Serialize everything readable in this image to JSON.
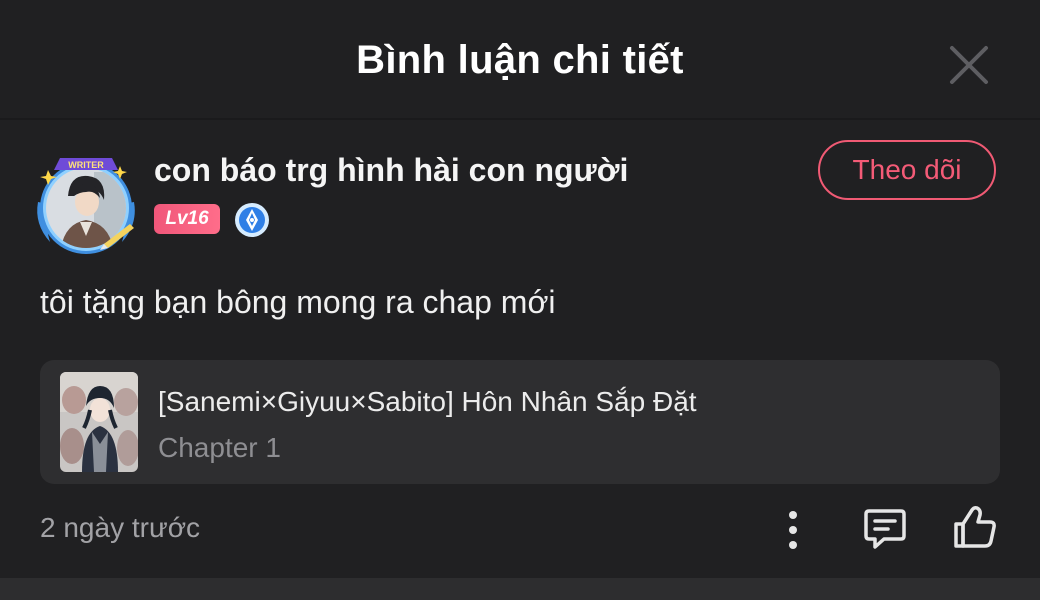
{
  "header": {
    "title": "Bình luận chi tiết",
    "close_icon": "close-icon"
  },
  "comment": {
    "author": {
      "name": "con báo trg hình hài con người",
      "avatar_frame_label": "WRITER",
      "level": "Lv16",
      "badge_icon": "writer-pen-badge-icon"
    },
    "follow_label": "Theo dõi",
    "text": "tôi tặng bạn bông mong ra chap mới",
    "story": {
      "title": "[Sanemi×Giyuu×Sabito] Hôn Nhân Sắp Đặt",
      "chapter": "Chapter 1"
    },
    "time": "2 ngày trước",
    "actions": [
      "more-icon",
      "reply-icon",
      "like-icon"
    ]
  },
  "colors": {
    "background": "#202022",
    "accent": "#f45b77",
    "card": "#2e2e30",
    "muted_text": "#8e8e92"
  }
}
